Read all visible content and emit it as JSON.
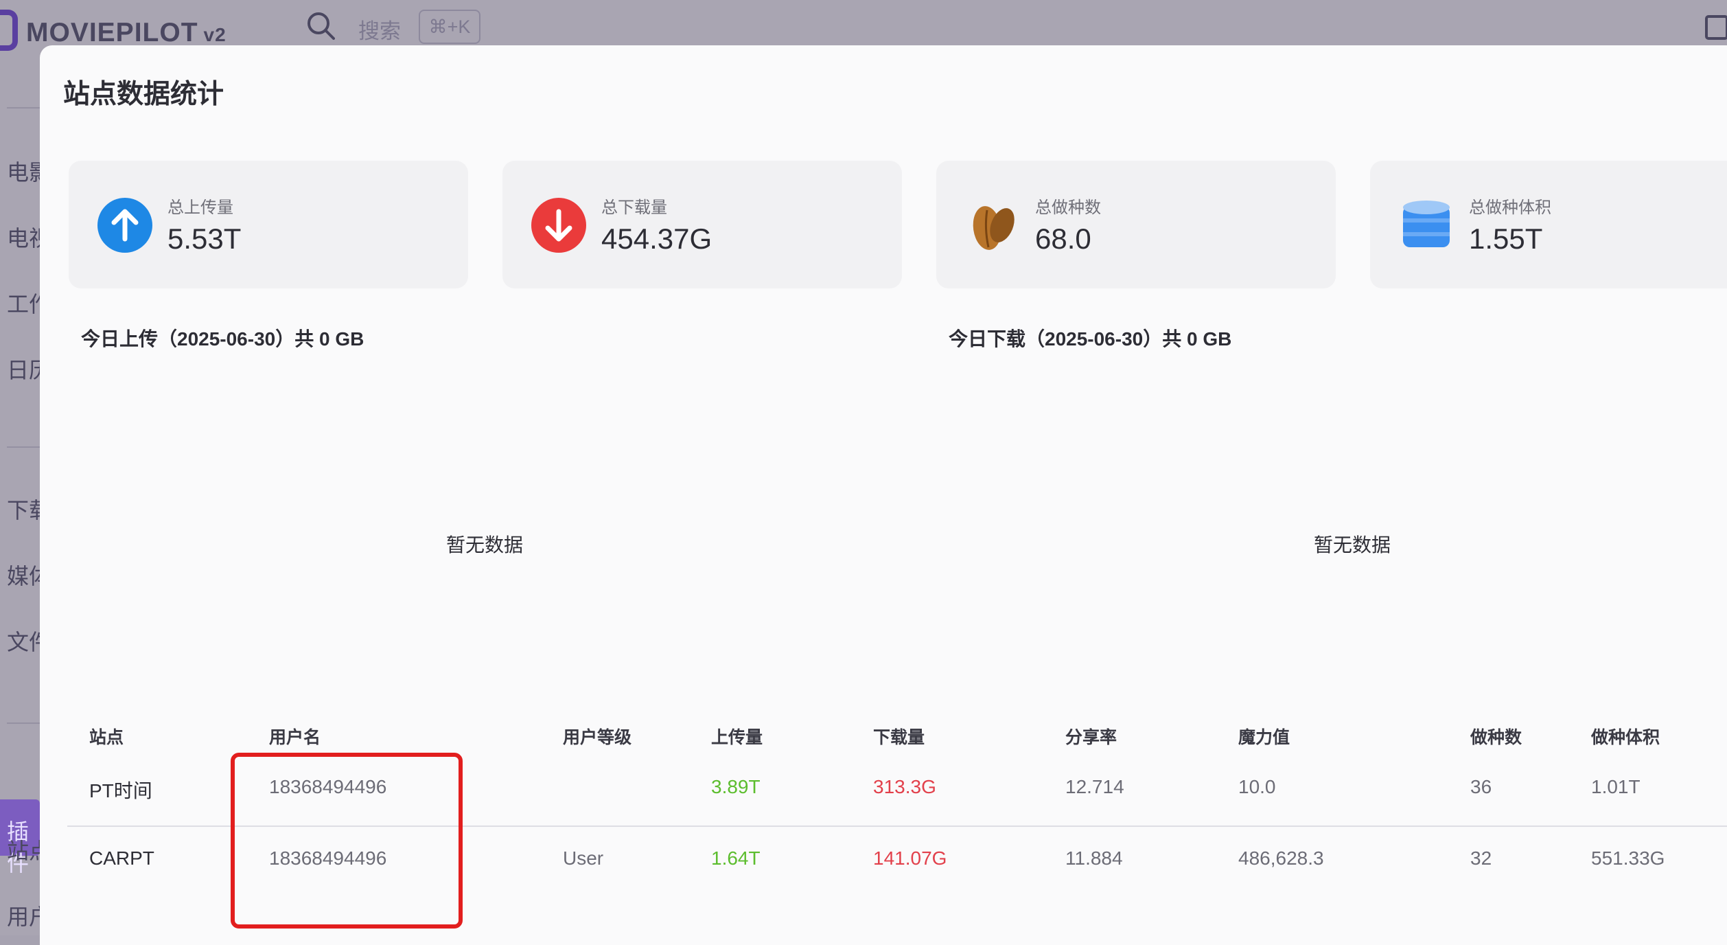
{
  "app": {
    "title": "MOVIEPILOT",
    "version": "v2",
    "search_placeholder": "搜索",
    "search_shortcut": "⌘+K"
  },
  "sidebar": {
    "items": [
      "电影",
      "电视",
      "工作",
      "日历",
      "下载",
      "媒体",
      "文件",
      "插件",
      "站点",
      "用户"
    ]
  },
  "dialog": {
    "title": "站点数据统计",
    "stats": [
      {
        "label": "总上传量",
        "value": "5.53T",
        "icon": "arrow-up-circle-icon",
        "color": "#1e88e5"
      },
      {
        "label": "总下载量",
        "value": "454.37G",
        "icon": "arrow-down-circle-icon",
        "color": "#ea3b3b"
      },
      {
        "label": "总做种数",
        "value": "68.0",
        "icon": "seed-icon",
        "color": "#b8742a"
      },
      {
        "label": "总做种体积",
        "value": "1.55T",
        "icon": "database-icon",
        "color": "#3b8ff0"
      }
    ],
    "today_upload": "今日上传（2025-06-30）共 0 GB",
    "today_download": "今日下载（2025-06-30）共 0 GB",
    "no_data_left": "暂无数据",
    "no_data_right": "暂无数据"
  },
  "table": {
    "headers": [
      "站点",
      "用户名",
      "用户等级",
      "上传量",
      "下载量",
      "分享率",
      "魔力值",
      "做种数",
      "做种体积"
    ],
    "rows": [
      {
        "site": "PT时间",
        "username": "18368494496",
        "level": "",
        "upload": "3.89T",
        "download": "313.3G",
        "ratio": "12.714",
        "bonus": "10.0",
        "seeds": "36",
        "seed_size": "1.01T"
      },
      {
        "site": "CARPT",
        "username": "18368494496",
        "level": "User",
        "upload": "1.64T",
        "download": "141.07G",
        "ratio": "11.884",
        "bonus": "486,628.3",
        "seeds": "32",
        "seed_size": "551.33G"
      }
    ]
  }
}
